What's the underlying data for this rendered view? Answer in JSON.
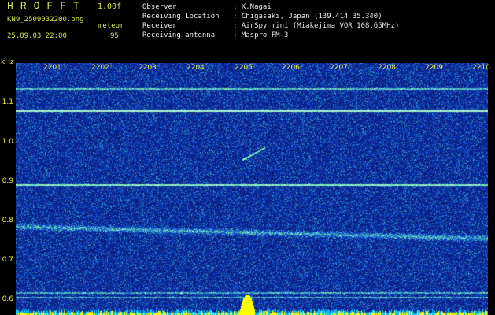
{
  "header": {
    "app_title": "HROFFT",
    "version": "1.00f",
    "filename": "KN9_2509032200.png",
    "mode": "meteor",
    "datetime": "25.09.03 22:00",
    "count": "95"
  },
  "station_info": [
    {
      "label": "Observer",
      "value": ": K.Nagai"
    },
    {
      "label": "Receiving Location",
      "value": ": Chigasaki, Japan (139.414 35.340)"
    },
    {
      "label": "Receiver",
      "value": ": AirSpy mini (Miakejima VOR 108.65MHz)"
    },
    {
      "label": "Receiving antenna",
      "value": ": Maspro FM-3"
    }
  ],
  "axis": {
    "y_unit": "kHz",
    "y_ticks": [
      "1.1",
      "1.0",
      "0.9",
      "0.8",
      "0.7",
      "0.6"
    ],
    "x_ticks": [
      "2201",
      "2202",
      "2203",
      "2204",
      "2205",
      "2206",
      "2207",
      "2208",
      "2209",
      "2210"
    ]
  },
  "colors": {
    "background": "#000000",
    "header_text": "#d8e84a",
    "info_text": "#e8e8e8",
    "noise_base": "#1a2aa0",
    "signal_line": "#40c8b0",
    "meteor_bar": "#ffff00",
    "baseline_bar": "#00c0ff"
  }
}
